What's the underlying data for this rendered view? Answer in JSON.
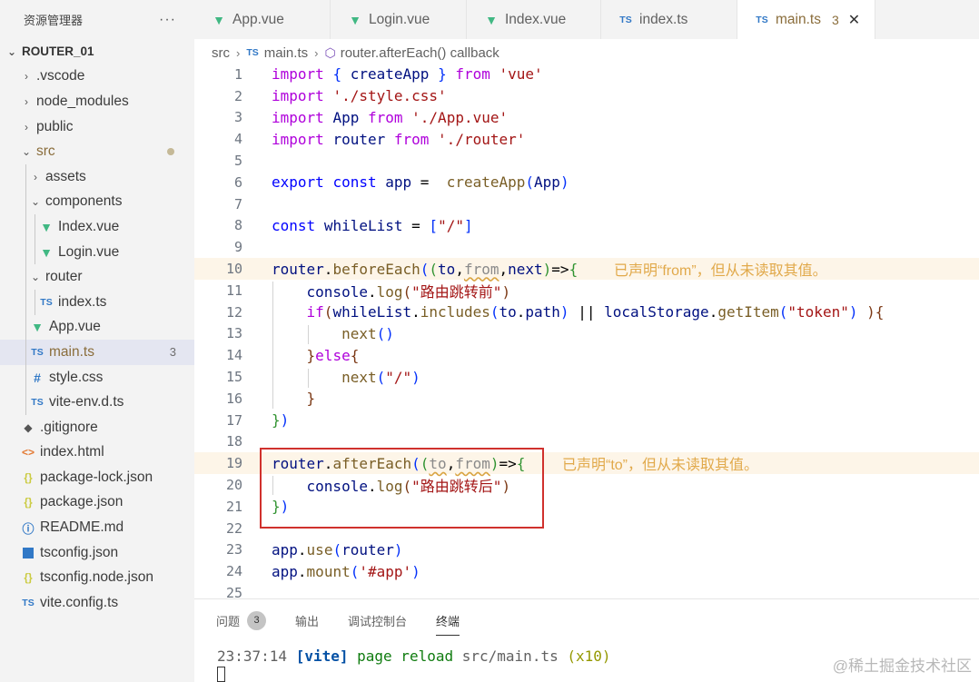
{
  "explorer": {
    "title": "资源管理器",
    "more": "···",
    "items": [
      {
        "label": "ROUTER_01",
        "level": 0,
        "type": "folder-open",
        "root": true
      },
      {
        "label": ".vscode",
        "level": 1,
        "type": "folder"
      },
      {
        "label": "node_modules",
        "level": 1,
        "type": "folder"
      },
      {
        "label": "public",
        "level": 1,
        "type": "folder"
      },
      {
        "label": "src",
        "level": 1,
        "type": "folder-open",
        "dot": true
      },
      {
        "label": "assets",
        "level": 2,
        "type": "folder"
      },
      {
        "label": "components",
        "level": 2,
        "type": "folder-open"
      },
      {
        "label": "Index.vue",
        "level": 3,
        "type": "vue"
      },
      {
        "label": "Login.vue",
        "level": 3,
        "type": "vue"
      },
      {
        "label": "router",
        "level": 2,
        "type": "folder-open"
      },
      {
        "label": "index.ts",
        "level": 3,
        "type": "ts"
      },
      {
        "label": "App.vue",
        "level": 2,
        "type": "vue"
      },
      {
        "label": "main.ts",
        "level": 2,
        "type": "ts",
        "selected": true,
        "badge": "3"
      },
      {
        "label": "style.css",
        "level": 2,
        "type": "css"
      },
      {
        "label": "vite-env.d.ts",
        "level": 2,
        "type": "ts"
      },
      {
        "label": ".gitignore",
        "level": 1,
        "type": "git"
      },
      {
        "label": "index.html",
        "level": 1,
        "type": "html"
      },
      {
        "label": "package-lock.json",
        "level": 1,
        "type": "json"
      },
      {
        "label": "package.json",
        "level": 1,
        "type": "json"
      },
      {
        "label": "README.md",
        "level": 1,
        "type": "info"
      },
      {
        "label": "tsconfig.json",
        "level": 1,
        "type": "tsconfig"
      },
      {
        "label": "tsconfig.node.json",
        "level": 1,
        "type": "json"
      },
      {
        "label": "vite.config.ts",
        "level": 1,
        "type": "ts"
      }
    ]
  },
  "tabs": [
    {
      "label": "App.vue",
      "type": "vue",
      "width": 150
    },
    {
      "label": "Login.vue",
      "type": "vue",
      "width": 150
    },
    {
      "label": "Index.vue",
      "type": "vue",
      "width": 148
    },
    {
      "label": "index.ts",
      "type": "ts",
      "width": 150
    },
    {
      "label": "main.ts",
      "type": "ts",
      "width": 152,
      "active": true,
      "badge": "3"
    }
  ],
  "icons": {
    "vue": "▼",
    "ts": "TS",
    "css": "#",
    "git": "◆",
    "html": "<>",
    "json": "{}",
    "info": "ⓘ",
    "folder": "›",
    "folder-open": "⌄",
    "close": "✕"
  },
  "breadcrumb": {
    "seg1": "src",
    "seg2_icon": "TS",
    "seg2": "main.ts",
    "seg3": "router.afterEach() callback"
  },
  "code": {
    "line_numbers": [
      "1",
      "2",
      "3",
      "4",
      "5",
      "6",
      "7",
      "8",
      "9",
      "10",
      "11",
      "12",
      "13",
      "14",
      "15",
      "16",
      "17",
      "18",
      "19",
      "20",
      "21",
      "22",
      "23",
      "24",
      "25"
    ],
    "warn_10": "已声明“from”，但从未读取其值。",
    "warn_19": "已声明“to”，但从未读取其值。"
  },
  "panel": {
    "tabs": [
      {
        "label": "问题",
        "badge": "3"
      },
      {
        "label": "输出"
      },
      {
        "label": "调试控制台"
      },
      {
        "label": "终端",
        "active": true
      }
    ],
    "terminal": {
      "time": "23:37:14",
      "tag": "[vite]",
      "msg": "page reload",
      "path": "src/main.ts",
      "count": "(x10)"
    }
  },
  "watermark": "@稀土掘金技术社区"
}
